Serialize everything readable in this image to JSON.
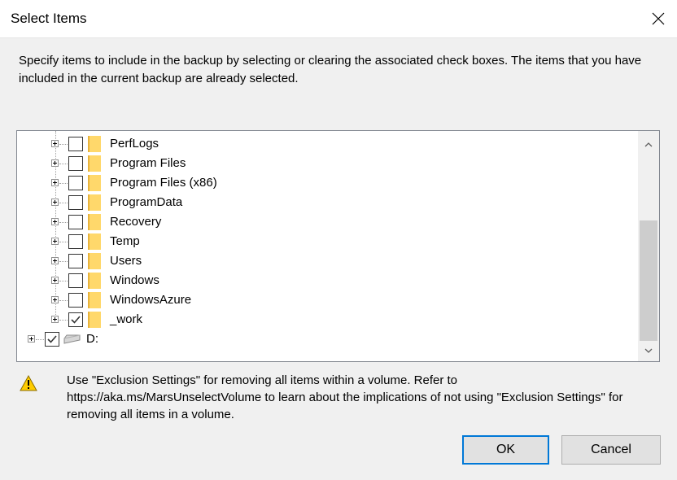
{
  "window": {
    "title": "Select Items"
  },
  "instructions": "Specify items to include in the backup by selecting or clearing the associated check boxes. The items that you have included in the current backup are already selected.",
  "tree": {
    "folders": [
      {
        "label": "PerfLogs",
        "checked": false
      },
      {
        "label": "Program Files",
        "checked": false
      },
      {
        "label": "Program Files (x86)",
        "checked": false
      },
      {
        "label": "ProgramData",
        "checked": false
      },
      {
        "label": "Recovery",
        "checked": false
      },
      {
        "label": "Temp",
        "checked": false
      },
      {
        "label": "Users",
        "checked": false
      },
      {
        "label": "Windows",
        "checked": false
      },
      {
        "label": "WindowsAzure",
        "checked": false
      },
      {
        "label": "_work",
        "checked": true
      }
    ],
    "drive": {
      "label": "D:",
      "checked": true
    }
  },
  "warning": "Use \"Exclusion Settings\" for removing all items within a volume. Refer to https://aka.ms/MarsUnselectVolume to learn about the implications of not using \"Exclusion Settings\" for removing all items in a volume.",
  "buttons": {
    "ok": "OK",
    "cancel": "Cancel"
  },
  "colors": {
    "accent": "#0078d7",
    "folder": "#ffd86b",
    "warning": "#ffcc00"
  }
}
